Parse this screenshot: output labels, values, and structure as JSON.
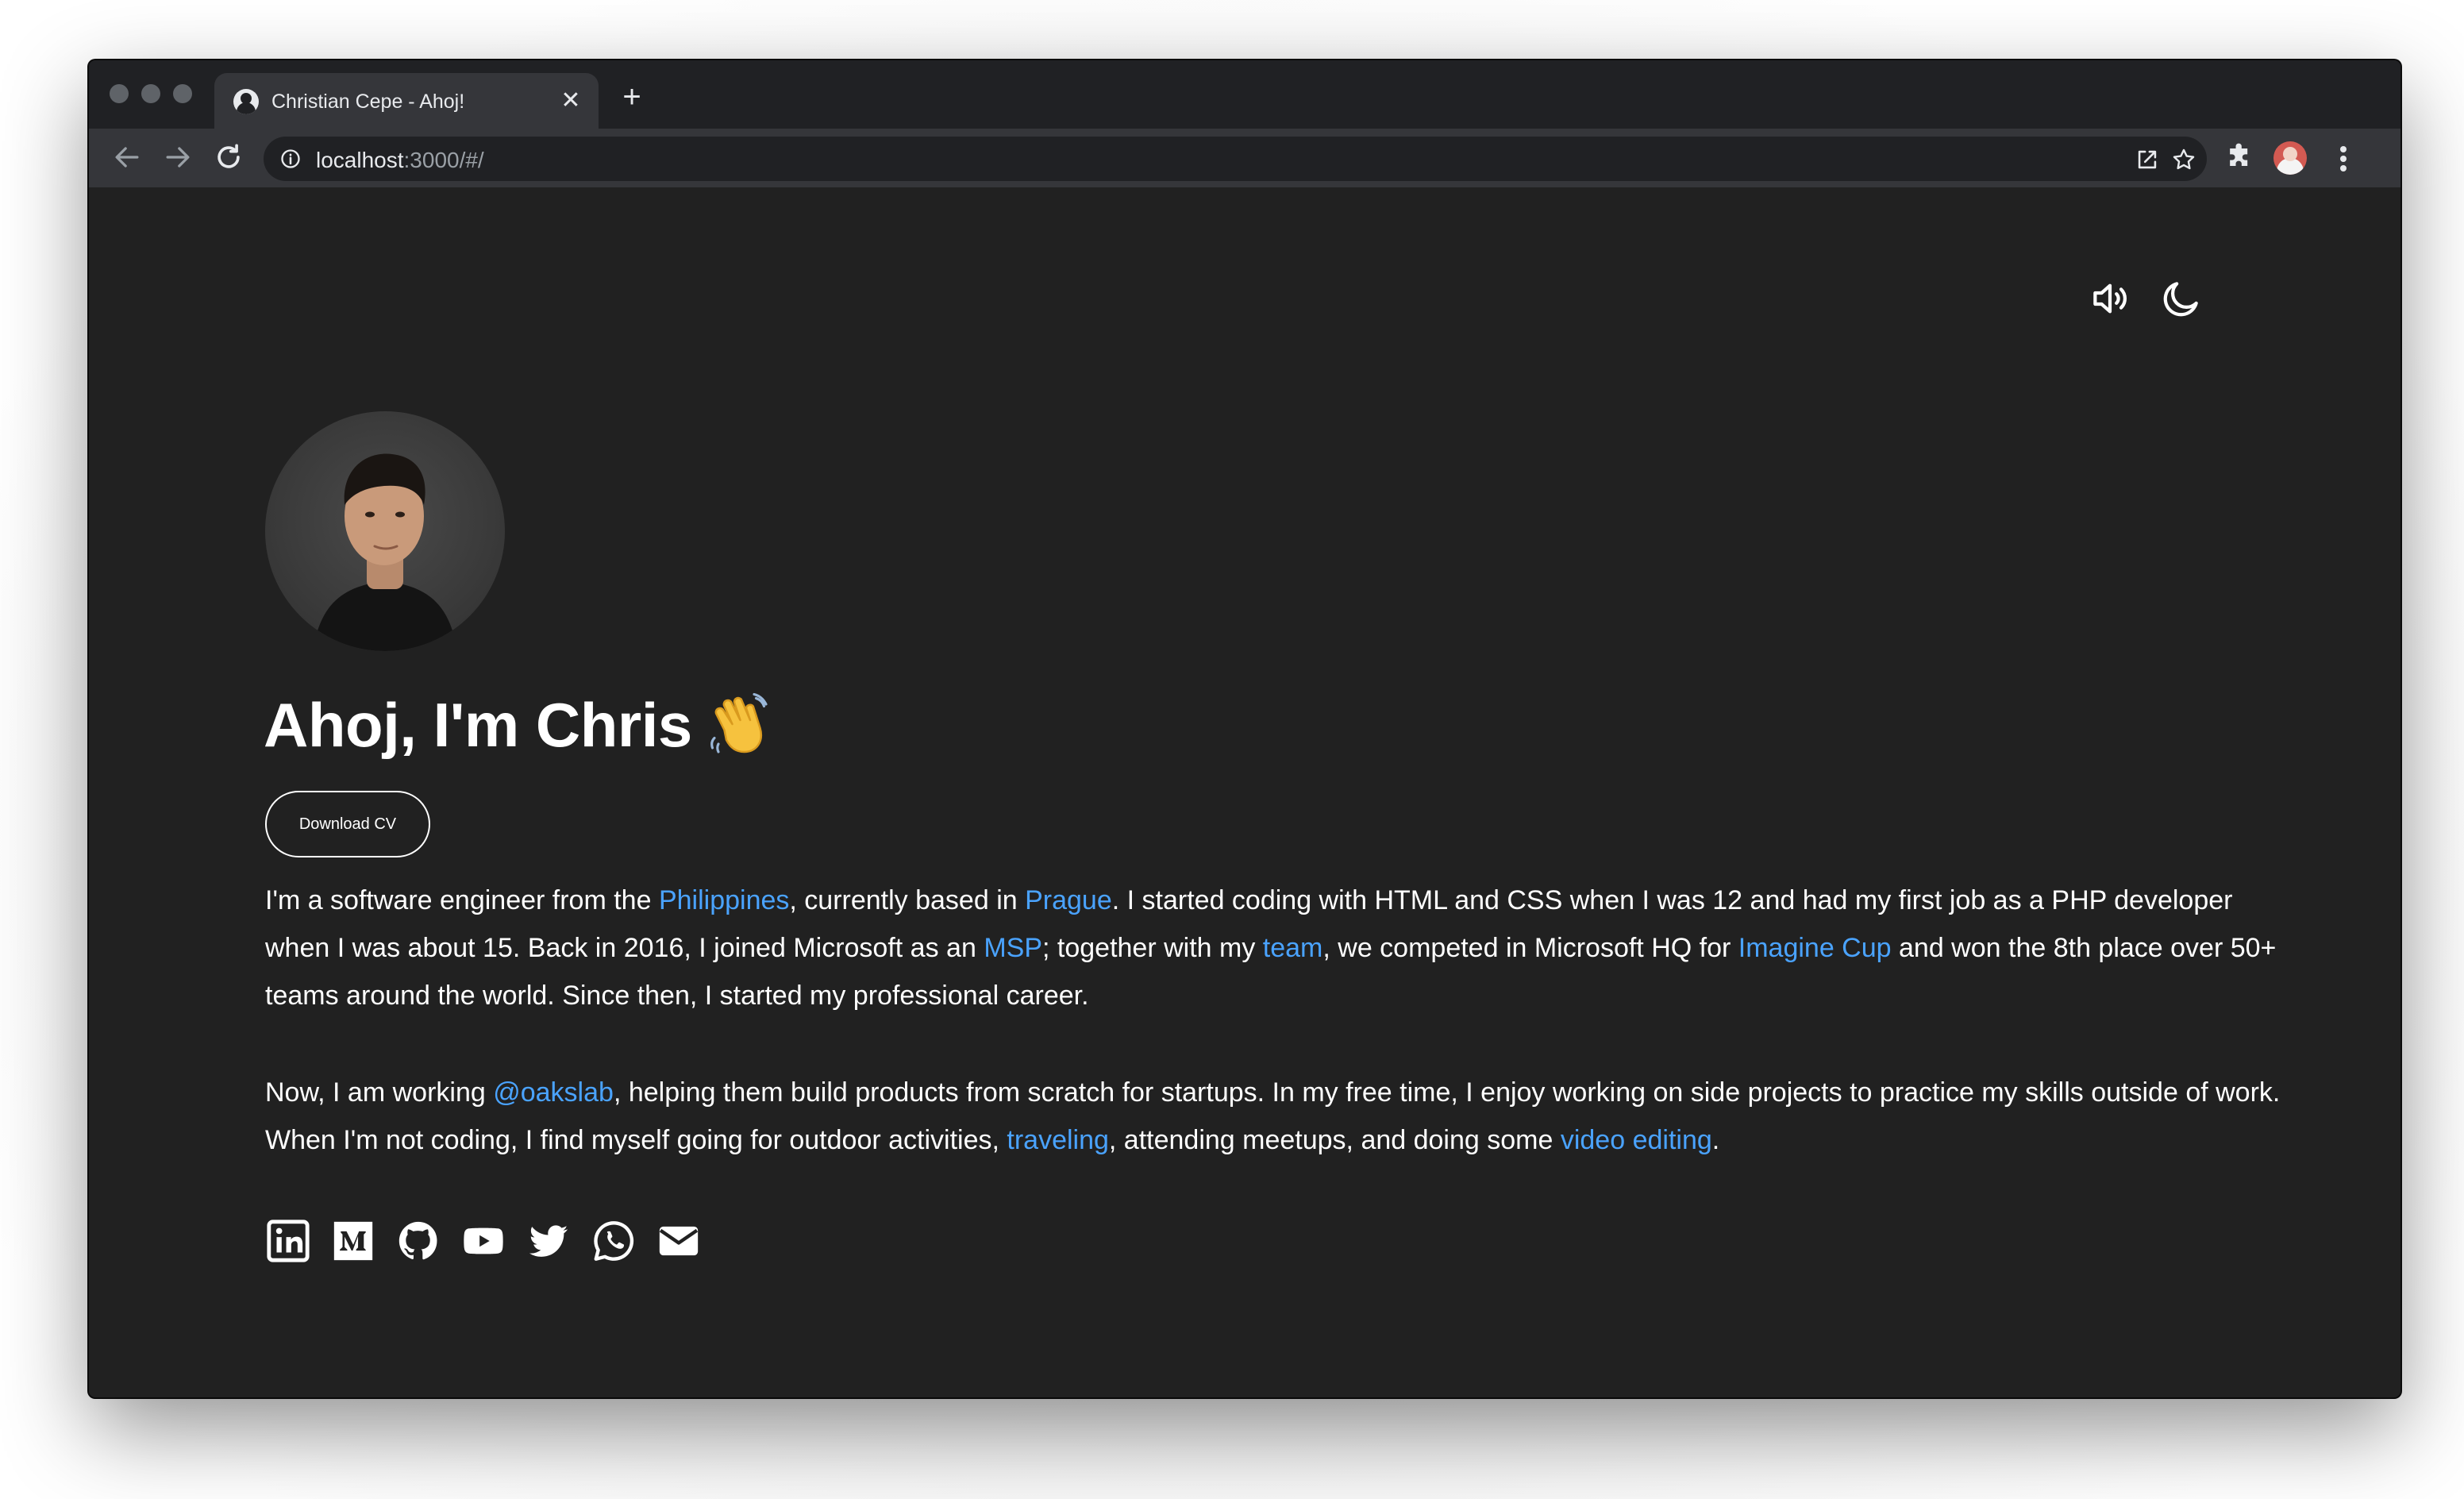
{
  "browser": {
    "tab_title": "Christian Cepe - Ahoj!",
    "tab_close": "✕",
    "new_tab": "+",
    "url_host": "localhost",
    "url_rest": ":3000/#/"
  },
  "header": {
    "sound_icon": "speaker-icon",
    "theme_icon": "moon-icon"
  },
  "hero": {
    "title": "Ahoj, I'm Chris",
    "emoji": "waving-hand",
    "download_label": "Download CV"
  },
  "bio": {
    "p1": {
      "t1": "I'm a software engineer from the ",
      "philippines": "Philippines",
      "t2": ", currently based in ",
      "prague": "Prague",
      "t3": ". I started coding with HTML and CSS when I was 12 and had my first job as a PHP developer when I was about 15. Back in 2016, I joined Microsoft as an ",
      "msp": "MSP",
      "t4": "; together with my ",
      "team": "team",
      "t5": ", we competed in Microsoft HQ for ",
      "imagine_cup": "Imagine Cup",
      "t6": " and won the 8th place over 50+ teams around the world. Since then, I started my professional career."
    },
    "p2": {
      "t1": "Now, I am working ",
      "oakslab": "@oakslab",
      "t2": ", helping them build products from scratch for startups. In my free time, I enjoy working on side projects to practice my skills outside of work. When I'm not coding, I find myself going for outdoor activities, ",
      "traveling": "traveling",
      "t3": ", attending meetups, and doing some ",
      "video_editing": "video editing",
      "t4": "."
    }
  },
  "socials": [
    "linkedin-icon",
    "medium-icon",
    "github-icon",
    "youtube-icon",
    "twitter-icon",
    "whatsapp-icon",
    "email-icon"
  ],
  "colors": {
    "page_bg": "#212121",
    "link": "#4aa3ff",
    "text": "#ffffff",
    "chrome_toolbar": "#35363a"
  }
}
